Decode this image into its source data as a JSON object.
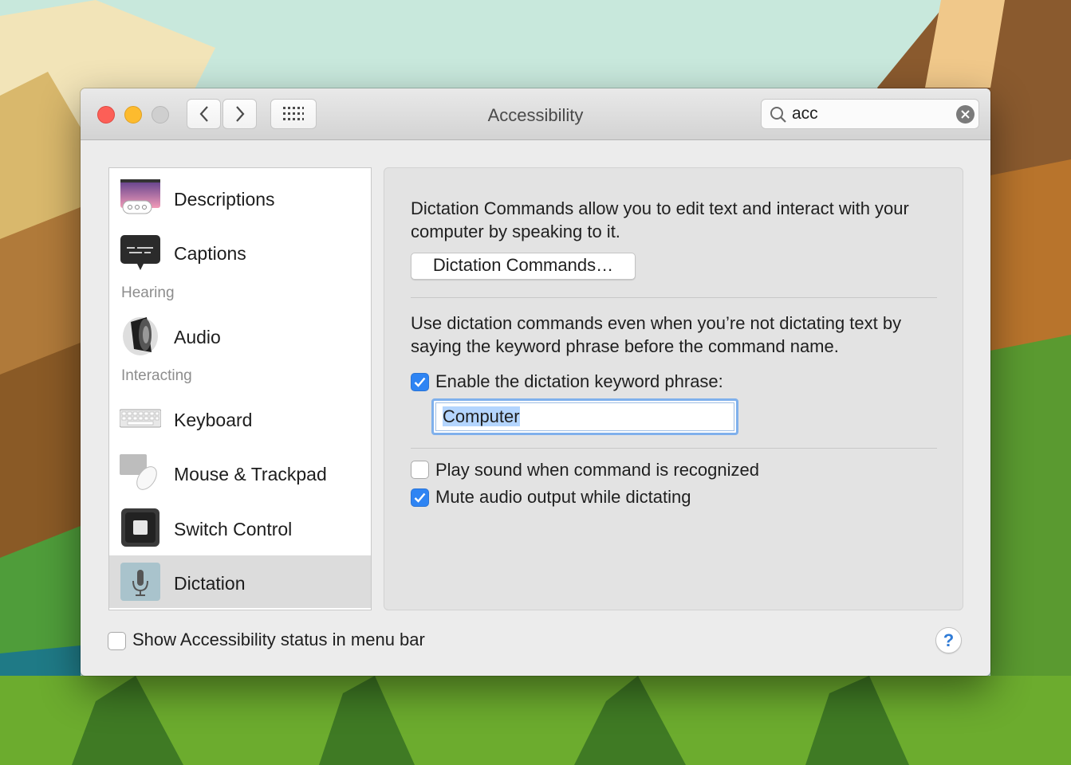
{
  "window": {
    "title": "Accessibility",
    "search": {
      "value": "acc",
      "placeholder": "Search"
    }
  },
  "sidebar": {
    "items": [
      {
        "label": "Descriptions",
        "icon": "descriptions-icon"
      },
      {
        "label": "Captions",
        "icon": "captions-icon"
      },
      {
        "label": "Audio",
        "icon": "speaker-icon"
      },
      {
        "label": "Keyboard",
        "icon": "keyboard-icon"
      },
      {
        "label": "Mouse & Trackpad",
        "icon": "mouse-trackpad-icon"
      },
      {
        "label": "Switch Control",
        "icon": "switch-control-icon"
      },
      {
        "label": "Dictation",
        "icon": "microphone-icon",
        "selected": true
      }
    ],
    "sections": {
      "hearing": "Hearing",
      "interacting": "Interacting"
    }
  },
  "panel": {
    "intro": "Dictation Commands allow you to edit text and interact with your computer by speaking to it.",
    "commands_button": "Dictation Commands…",
    "keyword_desc": "Use dictation commands even when you’re not dictating text by saying the keyword phrase before the command name.",
    "enable_keyword": {
      "label": "Enable the dictation keyword phrase:",
      "checked": true
    },
    "keyword_value": "Computer",
    "play_sound": {
      "label": "Play sound when command is recognized",
      "checked": false
    },
    "mute_audio": {
      "label": "Mute audio output while dictating",
      "checked": true
    }
  },
  "footer": {
    "show_status": {
      "label": "Show Accessibility status in menu bar",
      "checked": false
    },
    "help": "?"
  },
  "colors": {
    "accent": "#2e84f3",
    "close": "#fc5f57",
    "minimize": "#fdbb2e"
  }
}
